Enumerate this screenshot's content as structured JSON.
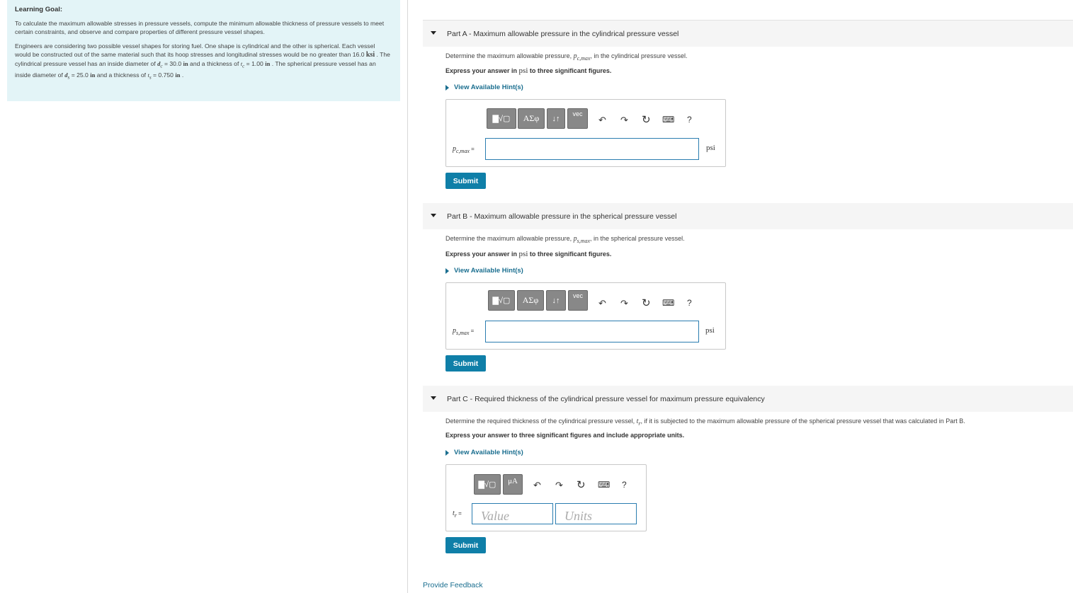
{
  "learning_goal": {
    "heading": "Learning Goal:",
    "p1": "To calculate the maximum allowable stresses in pressure vessels, compute the minimum allowable thickness of pressure vessels to meet certain constraints, and observe and compare properties of different pressure vessel shapes.",
    "p2_a": "Engineers are considering two possible vessel shapes for storing fuel. One shape is cylindrical and the other is spherical. Each vessel would be constructed out of the same material such that its hoop stresses and longitudinal stresses would be no greater than 16.0 ",
    "p2_ksi": "ksi",
    "p2_b": " . The cylindrical pressure vessel has an inside diameter of ",
    "dc_var": "d",
    "dc_sub": "c",
    "p2_c": " = 30.0 ",
    "unit_in": "in",
    "p2_d": " and a thickness of ",
    "tc_var": "t",
    "tc_sub": "c",
    "p2_e": " = 1.00 ",
    "p2_f": " . The spherical pressure vessel has an inside diameter of ",
    "ds_var": "d",
    "ds_sub": "s",
    "p2_g": " = 25.0 ",
    "p2_h": " and a thickness of ",
    "ts_var": "t",
    "ts_sub": "s",
    "p2_i": " = 0.750 ",
    "p2_j": " ."
  },
  "parts": {
    "a": {
      "label": "Part A",
      "title": " - Maximum allowable pressure in the cylindrical pressure vessel",
      "q_a": "Determine the maximum allowable pressure, ",
      "q_var": "p",
      "q_sub": "c,max",
      "q_b": ", in the cylindrical pressure vessel.",
      "express_a": "Express your answer in ",
      "express_unit": "psi",
      "express_b": " to three significant figures.",
      "hint": "View Available Hint(s)",
      "answer_label_var": "p",
      "answer_label_sub": "c,max",
      "answer_eq": " =",
      "unit": "psi",
      "submit": "Submit"
    },
    "b": {
      "label": "Part B",
      "title": " - Maximum allowable pressure in the spherical pressure vessel",
      "q_a": "Determine the maximum allowable pressure, ",
      "q_var": "p",
      "q_sub": "s,max",
      "q_b": ", in the spherical pressure vessel.",
      "express_a": "Express your answer in ",
      "express_unit": "psi",
      "express_b": " to three significant figures.",
      "hint": "View Available Hint(s)",
      "answer_label_var": "p",
      "answer_label_sub": "s,max",
      "answer_eq": " =",
      "unit": "psi",
      "submit": "Submit"
    },
    "c": {
      "label": "Part C",
      "title": " - Required thickness of the cylindrical pressure vessel for maximum pressure equivalency",
      "q_a": "Determine the required thickness of the cylindrical pressure vessel, ",
      "q_var": "t",
      "q_sub": "r",
      "q_b": ", if it is subjected to the maximum allowable pressure of the spherical pressure vessel that was calculated in Part B.",
      "express": "Express your answer to three significant figures and include appropriate units.",
      "hint": "View Available Hint(s)",
      "answer_label_var": "t",
      "answer_label_sub": "r",
      "answer_eq": " =",
      "value_placeholder": "Value",
      "units_placeholder": "Units",
      "submit": "Submit"
    }
  },
  "toolbar": {
    "templates": "▇√▢",
    "greek": "ΑΣφ",
    "arrows": "↓↑",
    "vec": "vec",
    "units_btn": "μA",
    "undo": "↶",
    "redo": "↷",
    "reset": "↻",
    "keyboard": "⌨",
    "help": "?"
  },
  "feedback": "Provide Feedback",
  "colors": {
    "accent": "#0f7fa8",
    "link": "#1a6e8f",
    "goal_bg": "#e3f4f7"
  }
}
